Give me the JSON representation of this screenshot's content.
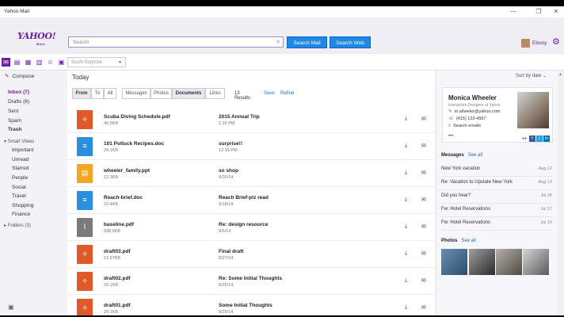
{
  "window": {
    "title": "Yahoo Mail",
    "min": "—",
    "max": "❐",
    "close": "✕"
  },
  "header": {
    "logo": "YAHOO!",
    "logo_sub": "MAIL",
    "search_placeholder": "Search",
    "search_clear": "✕",
    "search_mail": "Search Mail",
    "search_web": "Search Web",
    "user_name": "Ebony"
  },
  "toolbar": {
    "theme": "Sushi Surprise"
  },
  "sidebar": {
    "compose": "Compose",
    "folders": [
      {
        "label": "Inbox (7)"
      },
      {
        "label": "Drafts (6)"
      },
      {
        "label": "Sent"
      },
      {
        "label": "Spam"
      },
      {
        "label": "Trash"
      }
    ],
    "smart_views": "Smart Views",
    "smart_items": [
      {
        "label": "Important"
      },
      {
        "label": "Unread"
      },
      {
        "label": "Starred"
      },
      {
        "label": "People"
      },
      {
        "label": "Social"
      },
      {
        "label": "Travel"
      },
      {
        "label": "Shopping"
      },
      {
        "label": "Finance"
      }
    ],
    "folders_section": "Folders (3)"
  },
  "main": {
    "heading": "Today",
    "filters": {
      "from": "From",
      "to": "To",
      "all": "All",
      "messages": "Messages",
      "photos": "Photos",
      "documents": "Documents",
      "links": "Links"
    },
    "results": "13 Results",
    "save": "Save",
    "refine": "Refine",
    "files": [
      {
        "name": "Scuba Diving Schedule.pdf",
        "size": "46.6KB",
        "subject": "2015 Annual Trip",
        "date": "1:26 PM",
        "type": "pdf"
      },
      {
        "name": "101 Potluck Recipes.doc",
        "size": "29.1KB",
        "subject": "surprise!!",
        "date": "12:15 PM",
        "type": "doc"
      },
      {
        "name": "wheeler_family.ppt",
        "size": "12.3KB",
        "subject": "so shop",
        "date": "9/30/14",
        "type": "ppt"
      },
      {
        "name": "Reach-brief.doc",
        "size": "10.4KB",
        "subject": "Reach Brief-plz read",
        "date": "9/18/14",
        "type": "doc"
      },
      {
        "name": "baseline.pdf",
        "size": "938.6KB",
        "subject": "Re: design resource",
        "date": "9/6/14",
        "type": "clip"
      },
      {
        "name": "draft03.pdf",
        "size": "12.97KB",
        "subject": "Final draft",
        "date": "8/27/14",
        "type": "pdf"
      },
      {
        "name": "draft02.pdf",
        "size": "29.1KB",
        "subject": "Re: Some Initial Thoughts",
        "date": "8/25/14",
        "type": "pdf"
      },
      {
        "name": "draft01.pdf",
        "size": "29.1KB",
        "subject": "Some Initial Thoughts",
        "date": "8/25/14",
        "type": "pdf"
      }
    ]
  },
  "right": {
    "sort": "Sort by date ⌄",
    "contact": {
      "name": "Monica Wheeler",
      "title": "Interaction Designer at Yahoo",
      "email": "m.wheeler@yahoo.com",
      "phone": "(415) 123-4567",
      "search": "Search emails",
      "more": "•••"
    },
    "messages_label": "Messages",
    "see_all": "See all",
    "messages": [
      {
        "text": "New York vacation",
        "date": "Aug 12"
      },
      {
        "text": "Re: Vacation to Upstate New York",
        "date": "Aug 13"
      },
      {
        "text": "Did you hear?",
        "date": "Jul 20"
      },
      {
        "text": "Fw: Hotel Reservations",
        "date": "Jul 17"
      },
      {
        "text": "Fw: Hotel Reservations",
        "date": "Jul 15"
      }
    ],
    "photos_label": "Photos",
    "photos_see_all": "See all"
  },
  "colors": {
    "brand": "#6b1fa6",
    "button": "#1e88e5",
    "pdf": "#e0592a",
    "doc": "#2b8fe0",
    "ppt": "#f2a623",
    "clip": "#7a7a7a"
  }
}
